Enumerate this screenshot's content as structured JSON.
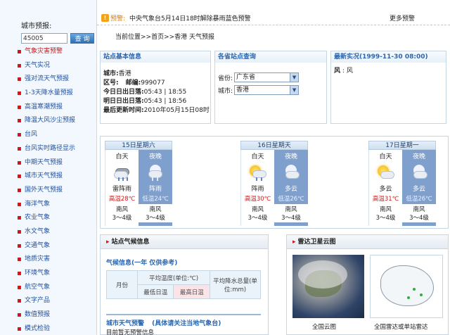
{
  "sidebar": {
    "search_label": "城市预报:",
    "search_value": "45005",
    "search_button": "查 询",
    "items": [
      {
        "label": "气象灾害预警",
        "active": true
      },
      {
        "label": "天气实况"
      },
      {
        "label": "强对流天气预报"
      },
      {
        "label": "1-3天降水量预报"
      },
      {
        "label": "高温寒潮预报"
      },
      {
        "label": "降温大风沙尘预报"
      },
      {
        "label": "台风"
      },
      {
        "label": "台风实时路径显示"
      },
      {
        "label": "中期天气预报"
      },
      {
        "label": "城市天气预报"
      },
      {
        "label": "国外天气预报"
      },
      {
        "label": "海洋气象"
      },
      {
        "label": "农业气象"
      },
      {
        "label": "水文气象"
      },
      {
        "label": "交通气象"
      },
      {
        "label": "地质灾害"
      },
      {
        "label": "环境气象"
      },
      {
        "label": "航空气象"
      },
      {
        "label": "文字产品"
      },
      {
        "label": "数值预报"
      },
      {
        "label": "模式检验"
      }
    ]
  },
  "alert": {
    "label": "预警:",
    "text": "中央气象台5月14日18时解除暴雨蓝色预警",
    "more": "更多预警"
  },
  "breadcrumb": "当前位置>>首页>>香港 天气预报",
  "station_info": {
    "title": "站点基本信息",
    "city_label": "城市:",
    "city": "香港",
    "zone_label": "区号:",
    "zip_label": "邮编:",
    "zip": "999077",
    "today_label": "今日日出日落:",
    "today": "05:43 | 18:55",
    "tomorrow_label": "明日日出日落:",
    "tomorrow": "05:43 | 18:56",
    "updated_label": "最后更新时间:",
    "updated": "2010年05月15日08时"
  },
  "province_query": {
    "title": "各省站点查询",
    "province_label": "省份:",
    "province": "广东省",
    "city_label": "城市:",
    "city": "香港"
  },
  "latest": {
    "title": "最新实况(1999-11-30 08:00)",
    "wind_label": "风",
    "wind_sep": ":",
    "wind": "风"
  },
  "forecast": [
    {
      "header": "15日星期六",
      "day": {
        "label": "白天",
        "weather": "雷阵雨",
        "temp": "高温28℃",
        "wind": "南风",
        "level": "3～4级"
      },
      "night": {
        "label": "夜晚",
        "weather": "阵雨",
        "temp": "低温24℃",
        "wind": "南风",
        "level": "3～4级"
      }
    },
    {
      "header": "16日星期天",
      "day": {
        "label": "白天",
        "weather": "阵雨",
        "temp": "高温30℃",
        "wind": "南风",
        "level": "3～4级"
      },
      "night": {
        "label": "夜晚",
        "weather": "多云",
        "temp": "低温26℃",
        "wind": "南风",
        "level": "3～4级"
      }
    },
    {
      "header": "17日星期一",
      "day": {
        "label": "白天",
        "weather": "多云",
        "temp": "高温31℃",
        "wind": "南风",
        "level": "3～4级"
      },
      "night": {
        "label": "夜晚",
        "weather": "多云",
        "temp": "低温26℃",
        "wind": "南风",
        "level": "3～4级"
      }
    }
  ],
  "climate": {
    "panel_title": "站点气候信息",
    "title": "气候信息(一年 仅供参考)",
    "month": "月份",
    "avg_temp": "平均温度(单位:℃)",
    "min_temp": "最低日温",
    "max_temp": "最高日温",
    "rain": "平均降水总量(单位:mm)",
    "city_forecast_title": "城市天气预警",
    "city_forecast_note": "(具体请关注当地气象台)",
    "city_forecast_sub": "目前暂无预警信息"
  },
  "radar": {
    "panel_title": "雷达卫星云图",
    "cloud_caption": "全国云图",
    "radar_caption": "全国雷达或单站雷达"
  },
  "colors": {
    "accent_blue": "#2a66b0",
    "alert_red": "#d01515",
    "night_column": "#7fa0cd"
  }
}
